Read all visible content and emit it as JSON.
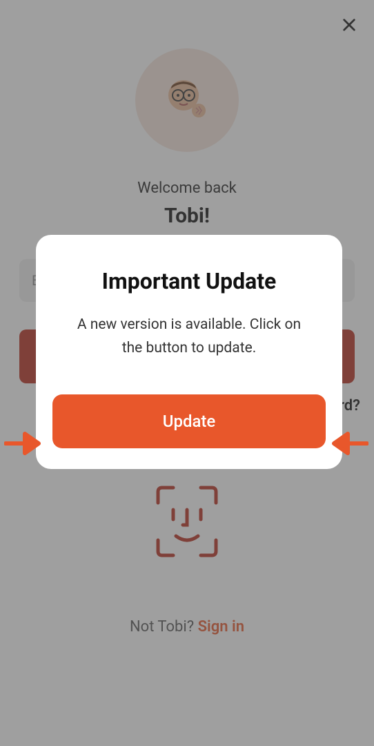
{
  "background": {
    "welcome": "Welcome back",
    "username": "Tobi!",
    "password_placeholder": "E",
    "forgot_link": "rd?",
    "not_user": "Not Tobi?  ",
    "signin_link": "Sign in"
  },
  "modal": {
    "title": "Important Update",
    "body": "A new version is available. Click on the button to update.",
    "button": "Update"
  },
  "colors": {
    "accent": "#e8572b",
    "dark_red": "#b82e1e"
  }
}
